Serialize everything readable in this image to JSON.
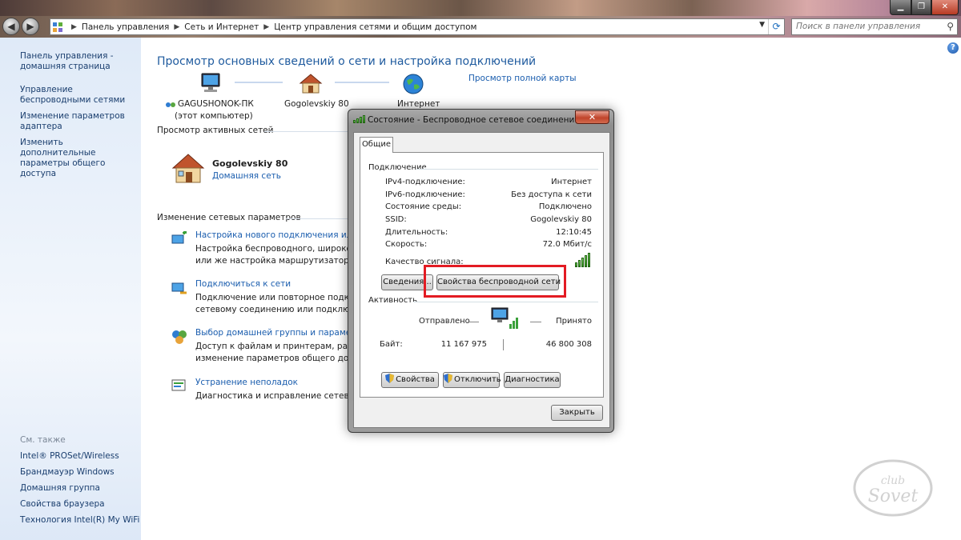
{
  "window": {
    "minimize_symbol": "▁",
    "maximize_symbol": "❐",
    "close_symbol": "✕"
  },
  "address_bar": {
    "crumbs": [
      "Панель управления",
      "Сеть и Интернет",
      "Центр управления сетями и общим доступом"
    ],
    "search_placeholder": "Поиск в панели управления"
  },
  "sidebar": {
    "links": [
      "Панель управления - домашняя страница",
      "Управление беспроводными сетями",
      "Изменение параметров адаптера",
      "Изменить дополнительные параметры общего доступа"
    ],
    "see_also_label": "См. также",
    "see_also": [
      "Intel® PROSet/Wireless",
      "Брандмауэр Windows",
      "Домашняя группа",
      "Свойства браузера",
      "Технология Intel(R) My WiFi"
    ]
  },
  "main": {
    "title": "Просмотр основных сведений о сети и настройка подключений",
    "full_map_link": "Просмотр полной карты",
    "map": {
      "computer_name": "GAGUSHONOK-ПК",
      "computer_sub": "(этот компьютер)",
      "network_name": "Gogolevskiy 80",
      "internet_label": "Интернет"
    },
    "active_networks_header": "Просмотр активных сетей",
    "active_network": {
      "name": "Gogolevskiy 80",
      "type": "Домашняя сеть"
    },
    "change_settings_header": "Изменение сетевых параметров",
    "tasks": [
      {
        "link": "Настройка нового подключения или се",
        "desc1": "Настройка беспроводного, широкопол",
        "desc2": "или же настройка маршрутизатора ил"
      },
      {
        "link": "Подключиться к сети",
        "desc1": "Подключение или повторное подклю",
        "desc2": "сетевому соединению или подключен"
      },
      {
        "link": "Выбор домашней группы и параметро",
        "desc1": "Доступ к файлам и принтерам, распол",
        "desc2": "изменение параметров общего доступ"
      },
      {
        "link": "Устранение неполадок",
        "desc1": "Диагностика и исправление сетевых пр"
      }
    ]
  },
  "dialog": {
    "title": "Состояние - Беспроводное сетевое соединение",
    "tab": "Общие",
    "connection_group": "Подключение",
    "rows": [
      {
        "key": "IPv4-подключение:",
        "value": "Интернет"
      },
      {
        "key": "IPv6-подключение:",
        "value": "Без доступа к сети"
      },
      {
        "key": "Состояние среды:",
        "value": "Подключено"
      },
      {
        "key": "SSID:",
        "value": "Gogolevskiy 80"
      },
      {
        "key": "Длительность:",
        "value": "12:10:45"
      },
      {
        "key": "Скорость:",
        "value": "72.0 Мбит/с"
      }
    ],
    "signal_label": "Качество сигнала:",
    "signal_bars": 5,
    "details_button": "Сведения...",
    "wireless_props_button": "Свойства беспроводной сети",
    "activity_group": "Активность",
    "sent_label": "Отправлено",
    "received_label": "Принято",
    "bytes_label": "Байт:",
    "bytes_sent": "11 167 975",
    "bytes_received": "46 800 308",
    "properties_button": "Свойства",
    "disable_button": "Отключить",
    "diagnose_button": "Диагностика",
    "close_button": "Закрыть"
  },
  "help_symbol": "?",
  "watermark_text": "club Sovet",
  "colors": {
    "link": "#1a5dae",
    "title": "#1e5a9e",
    "highlight": "#e31b23",
    "sidebar_bg": "#dfeaf8"
  }
}
